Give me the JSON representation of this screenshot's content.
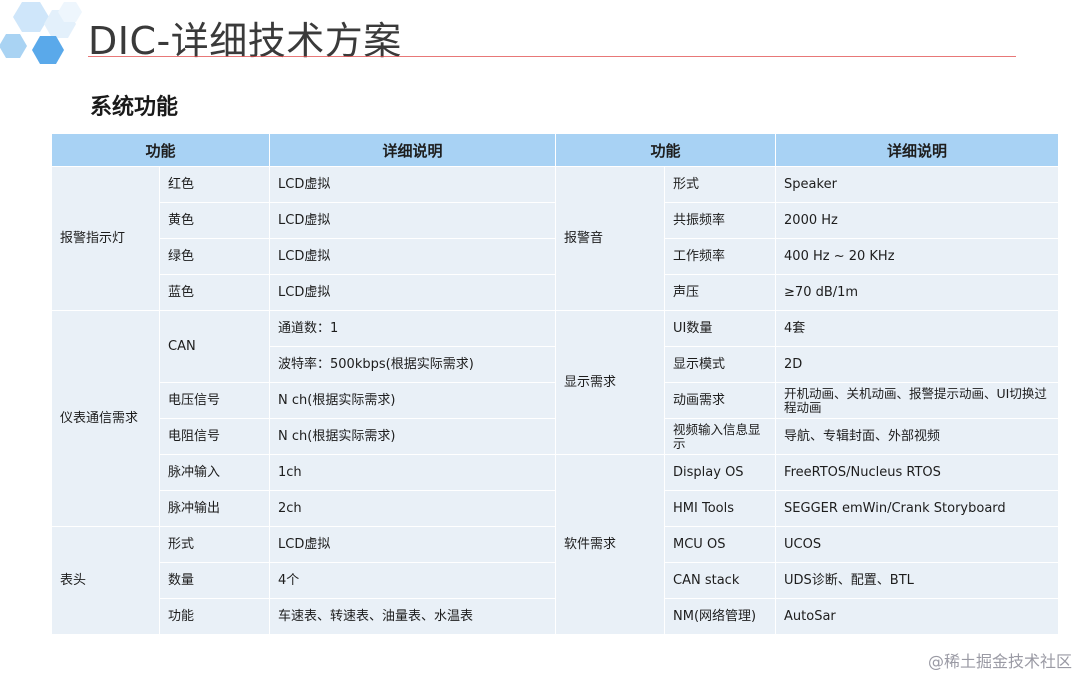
{
  "header": {
    "title": "DIC-详细技术方案"
  },
  "section": {
    "title": "系统功能"
  },
  "table": {
    "headers": [
      "功能",
      "详细说明",
      "功能",
      "详细说明"
    ],
    "left": {
      "alarm_light": {
        "group": "报警指示灯",
        "rows": [
          {
            "name": "红色",
            "desc": "LCD虚拟"
          },
          {
            "name": "黄色",
            "desc": "LCD虚拟"
          },
          {
            "name": "绿色",
            "desc": "LCD虚拟"
          },
          {
            "name": "蓝色",
            "desc": "LCD虚拟"
          }
        ]
      },
      "comm": {
        "group": "仪表通信需求",
        "can_label": "CAN",
        "can_channels": "通道数：1",
        "can_baud": "波特率：500kbps(根据实际需求)",
        "voltage": {
          "name": "电压信号",
          "desc": "N ch(根据实际需求)"
        },
        "resistance": {
          "name": "电阻信号",
          "desc": "N ch(根据实际需求)"
        },
        "pulse_in": {
          "name": "脉冲输入",
          "desc": "1ch"
        },
        "pulse_out": {
          "name": "脉冲输出",
          "desc": "2ch"
        }
      },
      "meter_head": {
        "group": "表头",
        "rows": [
          {
            "name": "形式",
            "desc": "LCD虚拟"
          },
          {
            "name": "数量",
            "desc": "4个"
          },
          {
            "name": "功能",
            "desc": "车速表、转速表、油量表、水温表"
          }
        ]
      }
    },
    "right": {
      "alarm_sound": {
        "group": "报警音",
        "rows": [
          {
            "name": "形式",
            "desc": "Speaker"
          },
          {
            "name": "共振频率",
            "desc": "2000 Hz"
          },
          {
            "name": "工作频率",
            "desc": "400 Hz ~ 20 KHz"
          },
          {
            "name": "声压",
            "desc": "≥70 dB/1m"
          }
        ]
      },
      "display": {
        "group": "显示需求",
        "rows": [
          {
            "name": "UI数量",
            "desc": "4套"
          },
          {
            "name": "显示模式",
            "desc": "2D"
          },
          {
            "name": "动画需求",
            "desc": "开机动画、关机动画、报警提示动画、UI切换过程动画"
          },
          {
            "name": "视频输入信息显示",
            "desc": "导航、专辑封面、外部视频"
          }
        ]
      },
      "software": {
        "group": "软件需求",
        "rows": [
          {
            "name": "Display OS",
            "desc": "FreeRTOS/Nucleus RTOS"
          },
          {
            "name": "HMI Tools",
            "desc": "SEGGER emWin/Crank Storyboard"
          },
          {
            "name": "MCU OS",
            "desc": "UCOS"
          },
          {
            "name": "CAN stack",
            "desc": "UDS诊断、配置、BTL"
          },
          {
            "name": "NM(网络管理)",
            "desc": "AutoSar"
          }
        ]
      }
    }
  },
  "footer": {
    "watermark": "@稀土掘金技术社区"
  },
  "colors": {
    "header_fill": "#a8d2f4",
    "cell_fill": "#e9f0f7",
    "title_rule": "#e04b4b",
    "hex_blue": "#5aa9ea",
    "hex_light": "#cfe6fa"
  }
}
